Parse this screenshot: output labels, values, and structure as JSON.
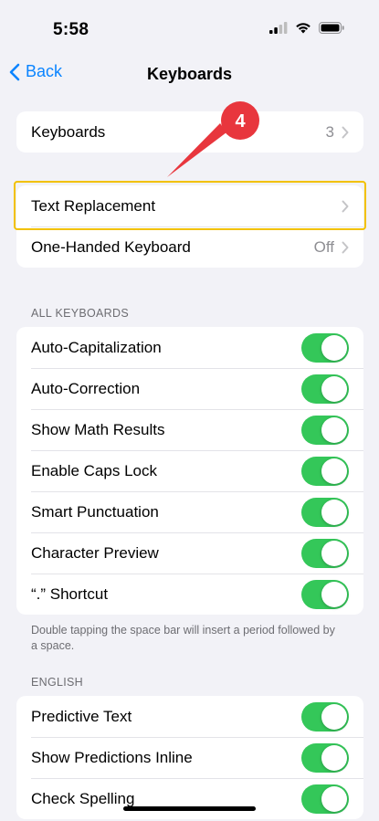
{
  "status": {
    "time": "5:58"
  },
  "nav": {
    "back_label": "Back",
    "title": "Keyboards"
  },
  "group1": {
    "keyboards": {
      "label": "Keyboards",
      "value": "3"
    }
  },
  "group2": {
    "text_replacement": {
      "label": "Text Replacement"
    },
    "one_handed": {
      "label": "One-Handed Keyboard",
      "value": "Off"
    }
  },
  "all_keyboards": {
    "header": "ALL KEYBOARDS",
    "items": [
      {
        "label": "Auto-Capitalization",
        "on": true
      },
      {
        "label": "Auto-Correction",
        "on": true
      },
      {
        "label": "Show Math Results",
        "on": true
      },
      {
        "label": "Enable Caps Lock",
        "on": true
      },
      {
        "label": "Smart Punctuation",
        "on": true
      },
      {
        "label": "Character Preview",
        "on": true
      },
      {
        "label": "“.” Shortcut",
        "on": true
      }
    ],
    "footnote": "Double tapping the space bar will insert a period followed by a space."
  },
  "english": {
    "header": "ENGLISH",
    "items": [
      {
        "label": "Predictive Text",
        "on": true
      },
      {
        "label": "Show Predictions Inline",
        "on": true
      },
      {
        "label": "Check Spelling",
        "on": true
      }
    ]
  },
  "annotation": {
    "step_number": "4",
    "color": "#e8363d"
  },
  "colors": {
    "accent": "#0a84ff",
    "toggle_on": "#34c759",
    "highlight_border": "#f2c100"
  }
}
